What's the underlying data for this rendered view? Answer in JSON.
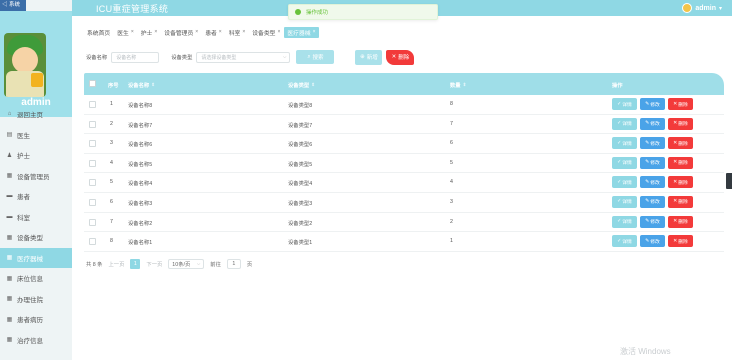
{
  "app": {
    "title": "ICU重症管理系统",
    "corner_tag": "◁ 系统"
  },
  "user": {
    "name": "admin",
    "caret": "▾"
  },
  "sidebar": {
    "admin_label": "admin",
    "items": [
      {
        "icon": "⌂",
        "label": "退回主页",
        "active": false
      },
      {
        "icon": "▤",
        "label": "医生",
        "active": false
      },
      {
        "icon": "♟",
        "label": "护士",
        "active": false
      },
      {
        "icon": "▦",
        "label": "设备管理员",
        "active": false
      },
      {
        "icon": "▬",
        "label": "患者",
        "active": false
      },
      {
        "icon": "▬",
        "label": "科室",
        "active": false
      },
      {
        "icon": "▦",
        "label": "设备类型",
        "active": false
      },
      {
        "icon": "▦",
        "label": "医疗器械",
        "active": true
      },
      {
        "icon": "▦",
        "label": "床位信息",
        "active": false
      },
      {
        "icon": "▦",
        "label": "办理住院",
        "active": false
      },
      {
        "icon": "▦",
        "label": "患者病历",
        "active": false
      },
      {
        "icon": "▦",
        "label": "治疗信息",
        "active": false
      }
    ]
  },
  "toast": {
    "text": "操作成功"
  },
  "tabs": [
    {
      "label": "系统首页",
      "closable": false,
      "active": false
    },
    {
      "label": "医生",
      "closable": true,
      "active": false
    },
    {
      "label": "护士",
      "closable": true,
      "active": false
    },
    {
      "label": "设备管理员",
      "closable": true,
      "active": false
    },
    {
      "label": "患者",
      "closable": true,
      "active": false
    },
    {
      "label": "科室",
      "closable": true,
      "active": false
    },
    {
      "label": "设备类型",
      "closable": true,
      "active": false
    },
    {
      "label": "医疗器械",
      "closable": true,
      "active": true
    }
  ],
  "tab_close_glyph": "×",
  "search": {
    "name_label": "设备名称",
    "name_placeholder": "设备名称",
    "type_label": "设备类型",
    "type_placeholder": "请选择设备类型",
    "search_btn": "搜索",
    "add_btn": "新增",
    "delete_btn": "删除"
  },
  "table": {
    "headers": {
      "index": "序号",
      "name": "设备名称",
      "type": "设备类型",
      "quantity": "数量",
      "actions": "操作"
    },
    "sort_glyph": "⇕",
    "rows": [
      {
        "index": "1",
        "name": "设备名称8",
        "type": "设备类型8",
        "quantity": "8"
      },
      {
        "index": "2",
        "name": "设备名称7",
        "type": "设备类型7",
        "quantity": "7"
      },
      {
        "index": "3",
        "name": "设备名称6",
        "type": "设备类型6",
        "quantity": "6"
      },
      {
        "index": "4",
        "name": "设备名称5",
        "type": "设备类型5",
        "quantity": "5"
      },
      {
        "index": "5",
        "name": "设备名称4",
        "type": "设备类型4",
        "quantity": "4"
      },
      {
        "index": "6",
        "name": "设备名称3",
        "type": "设备类型3",
        "quantity": "3"
      },
      {
        "index": "7",
        "name": "设备名称2",
        "type": "设备类型2",
        "quantity": "2"
      },
      {
        "index": "8",
        "name": "设备名称1",
        "type": "设备类型1",
        "quantity": "1"
      }
    ],
    "row_actions": {
      "view": "详情",
      "edit": "修改",
      "delete": "删除"
    }
  },
  "pagination": {
    "total": "共 8 条",
    "prev": "上一页",
    "current": "1",
    "next": "下一页",
    "page_size": "10条/页",
    "goto_label": "前往",
    "goto_value": "1",
    "goto_suffix": "页"
  },
  "watermark": "激活 Windows",
  "colors": {
    "primary": "#8fd8e4",
    "danger": "#f33a3a",
    "edit": "#4aa3e8",
    "success": "#67c23a"
  }
}
